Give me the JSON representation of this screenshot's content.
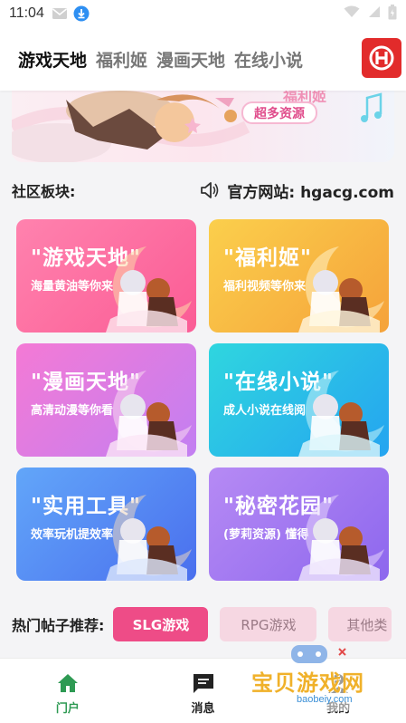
{
  "status_bar": {
    "time": "11:04",
    "icons": [
      "mail-icon",
      "download-icon",
      "wifi-icon",
      "signal-icon",
      "battery-icon"
    ]
  },
  "top_nav": {
    "tabs": [
      {
        "label": "游戏天地",
        "active": true
      },
      {
        "label": "福利姬",
        "active": false
      },
      {
        "label": "漫画天地",
        "active": false
      },
      {
        "label": "在线小说",
        "active": false
      }
    ],
    "logo_icon": "hgacg-logo"
  },
  "banner": {
    "tag": "超多资源"
  },
  "community": {
    "title": "社区板块:",
    "official_site": "官方网站: hgacg.com"
  },
  "cards": [
    {
      "title": "\"游戏天地\"",
      "subtitle": "海量黄油等你来",
      "color_from": "#ff7aa8",
      "color_to": "#fb5f97"
    },
    {
      "title": "\"福利姬\"",
      "subtitle": "福利视频等你来",
      "color_from": "#fbc84a",
      "color_to": "#f6a63a"
    },
    {
      "title": "\"漫画天地\"",
      "subtitle": "高清动漫等你看",
      "color_from": "#f37bd6",
      "color_to": "#c07cf1"
    },
    {
      "title": "\"在线小说\"",
      "subtitle": "成人小说在线阅",
      "color_from": "#2ed4e0",
      "color_to": "#27a8f0"
    },
    {
      "title": "\"实用工具\"",
      "subtitle": "效率玩机提效率",
      "color_from": "#5f9df8",
      "color_to": "#4a74ef"
    },
    {
      "title": "\"秘密花园\"",
      "subtitle": "(萝莉资源) 懂得",
      "color_from": "#b287f4",
      "color_to": "#8f69ee"
    }
  ],
  "hot_posts": {
    "label": "热门帖子推荐:",
    "chips": [
      {
        "label": "SLG游戏",
        "active": true
      },
      {
        "label": "RPG游戏",
        "active": false
      },
      {
        "label": "其他类",
        "active": false
      }
    ]
  },
  "bottom_nav": {
    "items": [
      {
        "label": "门户",
        "icon": "home-icon",
        "active": true
      },
      {
        "label": "消息",
        "icon": "message-icon",
        "active": false
      },
      {
        "label": "我的",
        "icon": "profile-icon",
        "active": false
      }
    ]
  },
  "watermark": {
    "text": "宝贝游戏网",
    "sub": "baobeiy.com"
  },
  "colors": {
    "accent_pink": "#ee4c87",
    "nav_active_green": "#2e9a53",
    "logo_red": "#e22b2b"
  }
}
